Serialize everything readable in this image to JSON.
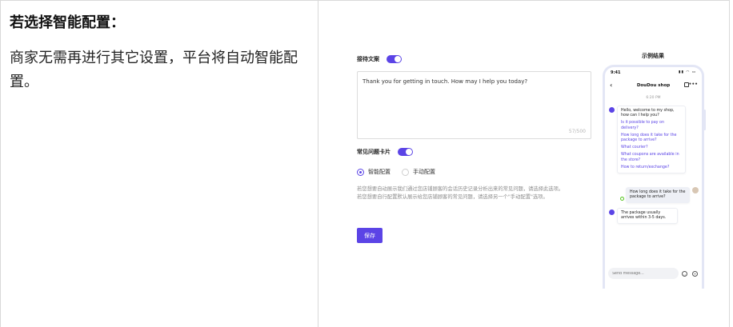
{
  "left": {
    "title": "若选择智能配置：",
    "body": "商家无需再进行其它设置，平台将自动智能配置。"
  },
  "settings": {
    "reply_label": "接待文案",
    "reply_text": "Thank you for getting in touch. How may I help you today?",
    "char_count": "57/500",
    "faq_label": "常见问题卡片",
    "option_smart": "智能配置",
    "option_manual": "手动配置",
    "hint_line1": "若您想要自动展示我们通过您店铺顾客的会话历史记录分析出来的常见问题，请选择此选项。",
    "hint_line2": "若您想要自行配置默认展示给您店铺顾客的常见问题，请选择另一个\"手动配置\"选项。",
    "save_label": "保存",
    "reply_toggle_on": true,
    "faq_toggle_on": true,
    "selected_option": "智能配置"
  },
  "preview": {
    "label": "示例结果",
    "status_time": "9:41",
    "status_icons": "▮▮ ◠ ▭",
    "shop_name": "DouDou shop",
    "chat_time": "6:20 PM",
    "greeting": "Hello, welcome to my shop, how can I help you?",
    "questions": [
      "Is it possible to pay on delivery?",
      "How long does it take for the package to arrive?",
      "What courier?",
      "What coupons are available in the store?",
      "How to return/exchange?"
    ],
    "user_message": "How long does it take for the package to arrive?",
    "bot_reply": "The package usually arrives within 3-5 days.",
    "input_placeholder": "Send message..."
  },
  "colors": {
    "accent": "#5b44e6",
    "border": "#d9d9d9",
    "hint": "#8c8c8c"
  }
}
